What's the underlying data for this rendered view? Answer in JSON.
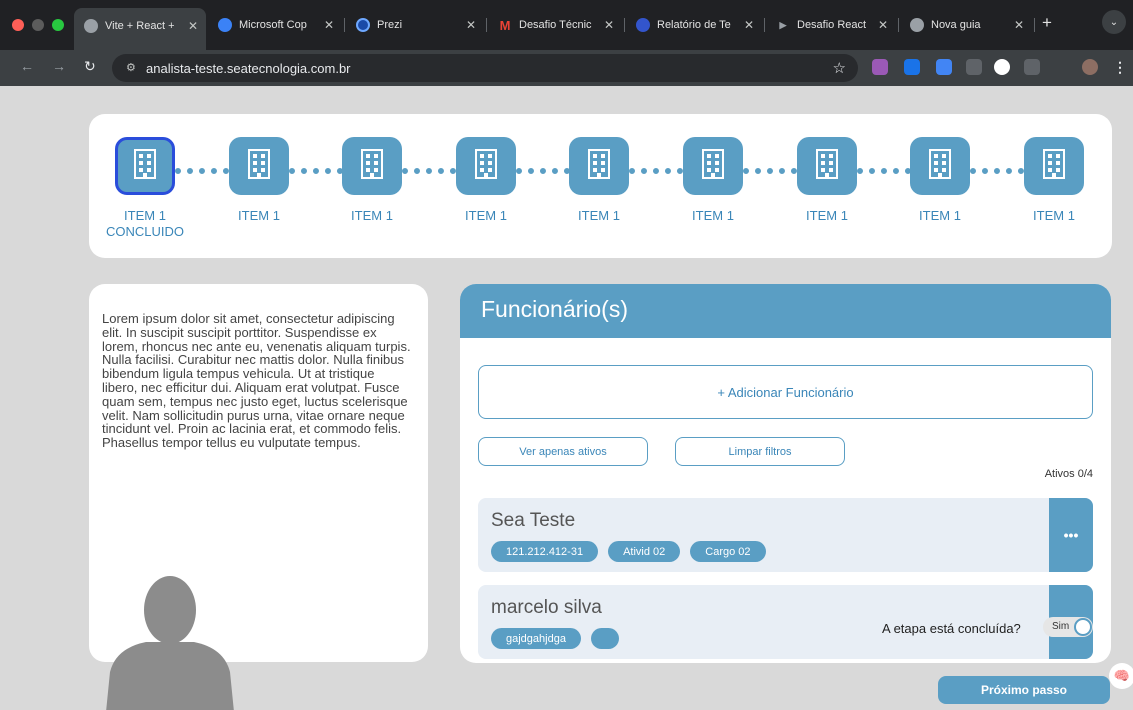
{
  "browser": {
    "tabs": [
      {
        "title": "Vite + React +",
        "favicon": "globe-icon",
        "active": true
      },
      {
        "title": "Microsoft Cop",
        "favicon": "copilot-icon"
      },
      {
        "title": "Prezi",
        "favicon": "prezi-icon"
      },
      {
        "title": "Desafio Técnic",
        "favicon": "gmail-icon",
        "favicon_text": "M"
      },
      {
        "title": "Relatório de Te",
        "favicon": "globe-blue-icon"
      },
      {
        "title": "Desafio React",
        "favicon": "play-icon"
      },
      {
        "title": "Nova guia",
        "favicon": "chrome-icon"
      }
    ],
    "new_tab_label": "+",
    "url": "analista-teste.seatecnologia.com.br"
  },
  "colors": {
    "accent": "#5a9ec4",
    "accent_text": "#3a86b8",
    "step_done_border": "#2a4ddb",
    "row_bg": "#e8eef5"
  },
  "stepper": {
    "steps": [
      {
        "label": "ITEM 1",
        "sublabel": "CONCLUIDO",
        "icon": "building-icon"
      },
      {
        "label": "ITEM 1",
        "icon": "building-icon"
      },
      {
        "label": "ITEM 1",
        "icon": "building-icon"
      },
      {
        "label": "ITEM 1",
        "icon": "building-icon"
      },
      {
        "label": "ITEM 1",
        "icon": "building-icon"
      },
      {
        "label": "ITEM 1",
        "icon": "building-icon"
      },
      {
        "label": "ITEM 1",
        "icon": "building-icon"
      },
      {
        "label": "ITEM 1",
        "icon": "building-icon"
      },
      {
        "label": "ITEM 1",
        "icon": "building-icon"
      }
    ]
  },
  "info": {
    "text": "Lorem ipsum dolor sit amet, consectetur adipiscing elit. In suscipit suscipit porttitor. Suspendisse ex lorem, rhoncus nec ante eu, venenatis aliquam turpis. Nulla facilisi. Curabitur nec mattis dolor. Nulla finibus bibendum ligula tempus vehicula. Ut at tristique libero, nec efficitur dui. Aliquam erat volutpat. Fusce quam sem, tempus nec justo eget, luctus scelerisque velit. Nam sollicitudin purus urna, vitae ornare neque tincidunt vel. Proin ac lacinia erat, et commodo felis. Phasellus tempor tellus eu vulputate tempus."
  },
  "employees": {
    "title": "Funcionário(s)",
    "add_label": "+ Adicionar Funcionário",
    "filter_active_label": "Ver apenas ativos",
    "clear_filters_label": "Limpar filtros",
    "active_count": "Ativos 0/4",
    "rows": [
      {
        "name": "Sea Teste",
        "chips": [
          "121.212.412-31",
          "Ativid 02",
          "Cargo 02"
        ],
        "menu_label": "•••"
      },
      {
        "name": "marcelo silva",
        "chips": [
          "gajdgahjdga",
          ""
        ]
      }
    ]
  },
  "footer": {
    "done_question": "A etapa está concluída?",
    "toggle_label": "Sim",
    "next_label": "Próximo passo"
  }
}
